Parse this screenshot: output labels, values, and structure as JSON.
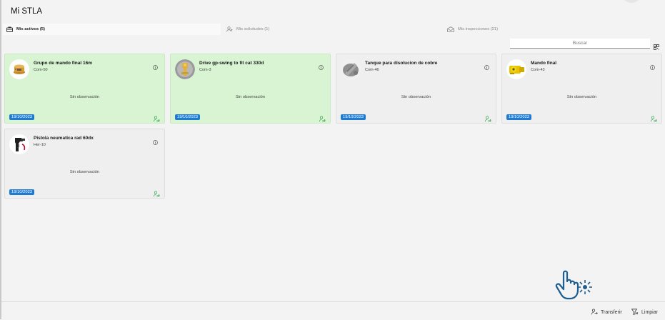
{
  "header": {
    "title": "Mi STLA"
  },
  "tabs": [
    {
      "label": "Mis activos (5)",
      "icon": "briefcase-icon",
      "active": true
    },
    {
      "label": "Mis solicitudes (1)",
      "icon": "person-add-icon",
      "active": false
    },
    {
      "label": "Mis inspecciones (21)",
      "icon": "envelope-open-icon",
      "active": false
    }
  ],
  "search": {
    "placeholder": "Buscar"
  },
  "assets": [
    {
      "title": "Grupo de mando final 16m",
      "code": "Com-50",
      "observation": "Sin observación",
      "date": "19/10/2023",
      "highlight": true,
      "image": "gear-assembly"
    },
    {
      "title": "Drive gp-swing to fit cat 330d",
      "code": "Com-3",
      "observation": "Sin observación",
      "date": "19/10/2023",
      "highlight": true,
      "image": "swing-drive"
    },
    {
      "title": "Tanque para disolucion de cobre",
      "code": "Com-46",
      "observation": "Sin observación",
      "date": "19/10/2023",
      "highlight": false,
      "image": "metal-tank"
    },
    {
      "title": "Mando final",
      "code": "Com-43",
      "observation": "Sin observación",
      "date": "19/10/2023",
      "highlight": false,
      "image": "yellow-final-drive"
    },
    {
      "title": "Pistola neumatica rad 60dx",
      "code": "Her-10",
      "observation": "Sin observación",
      "date": "19/10/2023",
      "highlight": false,
      "image": "pneumatic-gun"
    }
  ],
  "footer": {
    "transfer_label": "Transferir",
    "clear_label": "Limpiar"
  },
  "colors": {
    "highlight_bg": "#d8f4d2",
    "date_badge": "#1f7bd0",
    "transfer_icon": "#3aa655",
    "hand_cursor": "#1e5e91"
  }
}
